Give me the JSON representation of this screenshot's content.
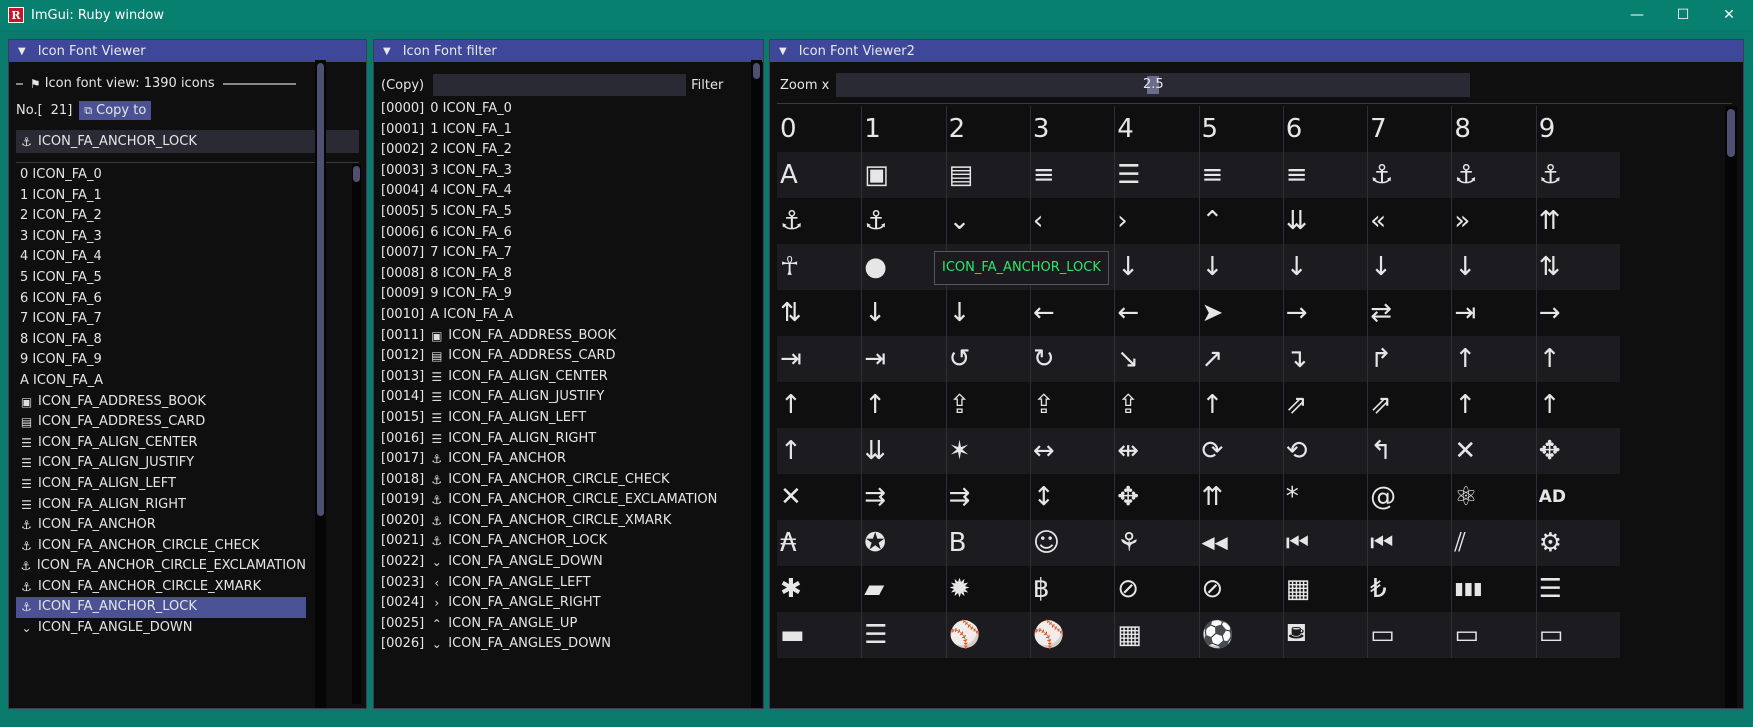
{
  "window": {
    "title": "ImGui: Ruby window",
    "minimize": "—",
    "maximize": "☐",
    "close": "✕"
  },
  "viewer": {
    "title": "Icon Font Viewer",
    "header_label": "Icon font view: 1390 icons",
    "no_label": "No.[",
    "no_value": "21]",
    "copy_button": "Copy to",
    "selected_name": "ICON_FA_ANCHOR_LOCK",
    "items": [
      {
        "icon": "",
        "text": "0 ICON_FA_0"
      },
      {
        "icon": "",
        "text": "1 ICON_FA_1"
      },
      {
        "icon": "",
        "text": "2 ICON_FA_2"
      },
      {
        "icon": "",
        "text": "3 ICON_FA_3"
      },
      {
        "icon": "",
        "text": "4 ICON_FA_4"
      },
      {
        "icon": "",
        "text": "5 ICON_FA_5"
      },
      {
        "icon": "",
        "text": "6 ICON_FA_6"
      },
      {
        "icon": "",
        "text": "7 ICON_FA_7"
      },
      {
        "icon": "",
        "text": "8 ICON_FA_8"
      },
      {
        "icon": "",
        "text": "9 ICON_FA_9"
      },
      {
        "icon": "",
        "text": "A ICON_FA_A"
      },
      {
        "icon": "▣",
        "text": "ICON_FA_ADDRESS_BOOK"
      },
      {
        "icon": "▤",
        "text": "ICON_FA_ADDRESS_CARD"
      },
      {
        "icon": "☰",
        "text": "ICON_FA_ALIGN_CENTER"
      },
      {
        "icon": "☰",
        "text": "ICON_FA_ALIGN_JUSTIFY"
      },
      {
        "icon": "☰",
        "text": "ICON_FA_ALIGN_LEFT"
      },
      {
        "icon": "☰",
        "text": "ICON_FA_ALIGN_RIGHT"
      },
      {
        "icon": "⚓",
        "text": "ICON_FA_ANCHOR"
      },
      {
        "icon": "⚓",
        "text": "ICON_FA_ANCHOR_CIRCLE_CHECK"
      },
      {
        "icon": "⚓",
        "text": "ICON_FA_ANCHOR_CIRCLE_EXCLAMATION"
      },
      {
        "icon": "⚓",
        "text": "ICON_FA_ANCHOR_CIRCLE_XMARK"
      },
      {
        "icon": "⚓",
        "text": "ICON_FA_ANCHOR_LOCK",
        "selected": true
      },
      {
        "icon": "⌄",
        "text": "ICON_FA_ANGLE_DOWN"
      }
    ]
  },
  "filter": {
    "title": "Icon Font filter",
    "copy_label": "(Copy)",
    "filter_label": "Filter",
    "filter_value": "",
    "items": [
      {
        "idx": "[0000]",
        "icon": "",
        "text": "0 ICON_FA_0"
      },
      {
        "idx": "[0001]",
        "icon": "",
        "text": "1 ICON_FA_1"
      },
      {
        "idx": "[0002]",
        "icon": "",
        "text": "2 ICON_FA_2"
      },
      {
        "idx": "[0003]",
        "icon": "",
        "text": "3 ICON_FA_3"
      },
      {
        "idx": "[0004]",
        "icon": "",
        "text": "4 ICON_FA_4"
      },
      {
        "idx": "[0005]",
        "icon": "",
        "text": "5 ICON_FA_5"
      },
      {
        "idx": "[0006]",
        "icon": "",
        "text": "6 ICON_FA_6"
      },
      {
        "idx": "[0007]",
        "icon": "",
        "text": "7 ICON_FA_7"
      },
      {
        "idx": "[0008]",
        "icon": "",
        "text": "8 ICON_FA_8"
      },
      {
        "idx": "[0009]",
        "icon": "",
        "text": "9 ICON_FA_9"
      },
      {
        "idx": "[0010]",
        "icon": "",
        "text": "A ICON_FA_A"
      },
      {
        "idx": "[0011]",
        "icon": "▣",
        "text": "ICON_FA_ADDRESS_BOOK"
      },
      {
        "idx": "[0012]",
        "icon": "▤",
        "text": "ICON_FA_ADDRESS_CARD"
      },
      {
        "idx": "[0013]",
        "icon": "☰",
        "text": "ICON_FA_ALIGN_CENTER"
      },
      {
        "idx": "[0014]",
        "icon": "☰",
        "text": "ICON_FA_ALIGN_JUSTIFY"
      },
      {
        "idx": "[0015]",
        "icon": "☰",
        "text": "ICON_FA_ALIGN_LEFT"
      },
      {
        "idx": "[0016]",
        "icon": "☰",
        "text": "ICON_FA_ALIGN_RIGHT"
      },
      {
        "idx": "[0017]",
        "icon": "⚓",
        "text": "ICON_FA_ANCHOR"
      },
      {
        "idx": "[0018]",
        "icon": "⚓",
        "text": "ICON_FA_ANCHOR_CIRCLE_CHECK"
      },
      {
        "idx": "[0019]",
        "icon": "⚓",
        "text": "ICON_FA_ANCHOR_CIRCLE_EXCLAMATION"
      },
      {
        "idx": "[0020]",
        "icon": "⚓",
        "text": "ICON_FA_ANCHOR_CIRCLE_XMARK"
      },
      {
        "idx": "[0021]",
        "icon": "⚓",
        "text": "ICON_FA_ANCHOR_LOCK"
      },
      {
        "idx": "[0022]",
        "icon": "⌄",
        "text": "ICON_FA_ANGLE_DOWN"
      },
      {
        "idx": "[0023]",
        "icon": "‹",
        "text": "ICON_FA_ANGLE_LEFT"
      },
      {
        "idx": "[0024]",
        "icon": "›",
        "text": "ICON_FA_ANGLE_RIGHT"
      },
      {
        "idx": "[0025]",
        "icon": "⌃",
        "text": "ICON_FA_ANGLE_UP"
      },
      {
        "idx": "[0026]",
        "icon": "⌄",
        "text": "ICON_FA_ANGLES_DOWN"
      }
    ]
  },
  "viewer2": {
    "title": "Icon Font Viewer2",
    "zoom_label": "Zoom x",
    "zoom_value": "2.5",
    "zoom_fraction": 0.5,
    "tooltip": "ICON_FA_ANCHOR_LOCK",
    "columns": [
      "0",
      "1",
      "2",
      "3",
      "4",
      "5",
      "6",
      "7",
      "8",
      "9"
    ],
    "rows": [
      [
        "A",
        "▣",
        "▤",
        "≡",
        "☰",
        "≡",
        "≡",
        "⚓",
        "⚓",
        "⚓"
      ],
      [
        "⚓",
        "⚓",
        "⌄",
        "‹",
        "›",
        "⌃",
        "⇊",
        "«",
        "»",
        "⇈"
      ],
      [
        "☥",
        "●",
        "⚐",
        "▼",
        "↓",
        "↓",
        "↓",
        "↓",
        "↓",
        "⇅"
      ],
      [
        "⇅",
        "↓",
        "↓",
        "←",
        "←",
        "➤",
        "→",
        "⇄",
        "⇥",
        "→"
      ],
      [
        "⇥",
        "⇥",
        "↺",
        "↻",
        "↘",
        "↗",
        "↴",
        "↱",
        "↑",
        "↑"
      ],
      [
        "↑",
        "↑",
        "⇪",
        "⇪",
        "⇪",
        "↑",
        "⇗",
        "⇗",
        "↑",
        "↑"
      ],
      [
        "↑",
        "⇊",
        "✶",
        "↔",
        "⇹",
        "⟳",
        "⟲",
        "↰",
        "✕",
        "✥"
      ],
      [
        "✕",
        "⇉",
        "⇉",
        "↕",
        "✥",
        "⇈",
        "*",
        "@",
        "⚛",
        "AD"
      ],
      [
        "₳",
        "✪",
        "B",
        "☺",
        "⚘",
        "◀◀",
        "⏮",
        "⏮",
        "⫽",
        "⚙"
      ],
      [
        "✱",
        "▰",
        "✹",
        "฿",
        "⊘",
        "⊘",
        "▦",
        "₺",
        "▮▮▮",
        "☰"
      ],
      [
        "▬",
        "☰",
        "⚾",
        "⚾",
        "▦",
        "⚽",
        "⛾",
        "▭",
        "▭",
        "▭"
      ]
    ]
  }
}
